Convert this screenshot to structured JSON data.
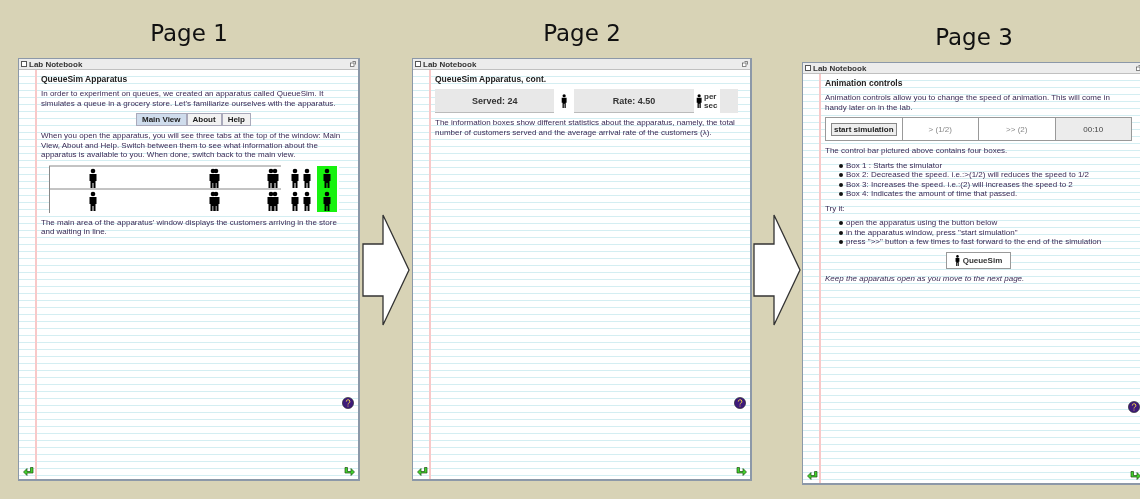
{
  "pages": [
    {
      "label": "Page 1",
      "window_title": "Lab Notebook",
      "blocks": [
        {
          "kind": "heading",
          "text": "QueueSim Apparatus"
        },
        {
          "kind": "paragraph",
          "text": "In order to experiment on queues, we created an apparatus called QueueSim. It simulates a queue in a grocery store. Let's familiarize ourselves with the apparatus."
        },
        {
          "kind": "tabs",
          "items": [
            {
              "label": "Main View",
              "selected": true
            },
            {
              "label": "About",
              "selected": false
            },
            {
              "label": "Help",
              "selected": false
            }
          ]
        },
        {
          "kind": "paragraph",
          "text": "When you open the apparatus, you will see three tabs at the top of the window: Main View, About and Help. Switch between them to see what information about the apparatus is available to you. When done, switch back to the main view."
        },
        {
          "kind": "queue"
        },
        {
          "kind": "paragraph",
          "text": "The main area of the apparatus' window displays the customers arriving in the store and waiting in line."
        }
      ]
    },
    {
      "label": "Page 2",
      "window_title": "Lab Notebook",
      "blocks": [
        {
          "kind": "heading",
          "text": "QueueSim Apparatus, cont."
        },
        {
          "kind": "stats",
          "items": [
            {
              "kind": "value",
              "text": "Served: 24"
            },
            {
              "kind": "icon"
            },
            {
              "kind": "value",
              "text": "Rate: 4.50"
            },
            {
              "kind": "unit",
              "text": "per sec"
            }
          ]
        },
        {
          "kind": "paragraph",
          "text": "The information boxes show different statistics about the apparatus, namely, the total number of customers served and the average arrival rate of the customers (λ)."
        }
      ]
    },
    {
      "label": "Page 3",
      "window_title": "Lab Notebook",
      "blocks": [
        {
          "kind": "heading",
          "text": "Animation controls"
        },
        {
          "kind": "paragraph",
          "text": "Animation controls allow you to change the speed of animation. This will come in handy later on in the lab."
        },
        {
          "kind": "controls",
          "items": [
            {
              "kind": "button",
              "text": "start simulation"
            },
            {
              "kind": "speed",
              "text": "> (1/2)"
            },
            {
              "kind": "speed",
              "text": ">> (2)"
            },
            {
              "kind": "clock",
              "text": "00:10"
            }
          ]
        },
        {
          "kind": "paragraph",
          "text": "The control bar pictured above contains four boxes."
        },
        {
          "kind": "list",
          "items": [
            "Box 1 : Starts the simulator",
            "Box 2: Decreased the speed. i.e.:>(1/2) will reduces the speed to 1/2",
            "Box 3: Increases the speed. i.e.:(2) will increases the speed to 2",
            "Box 4: Indicates the amount of time that passed."
          ]
        },
        {
          "kind": "paragraph",
          "text": "Try it:"
        },
        {
          "kind": "list",
          "items": [
            "open the apparatus using the button below",
            "in the apparatus window, press \"start simulation\"",
            "press \">>\" button a few times to fast forward to the end of the simulation"
          ]
        },
        {
          "kind": "launch",
          "text": "QueueSim"
        },
        {
          "kind": "note",
          "text": "Keep the apparatus open as you move to the next page."
        }
      ]
    }
  ]
}
